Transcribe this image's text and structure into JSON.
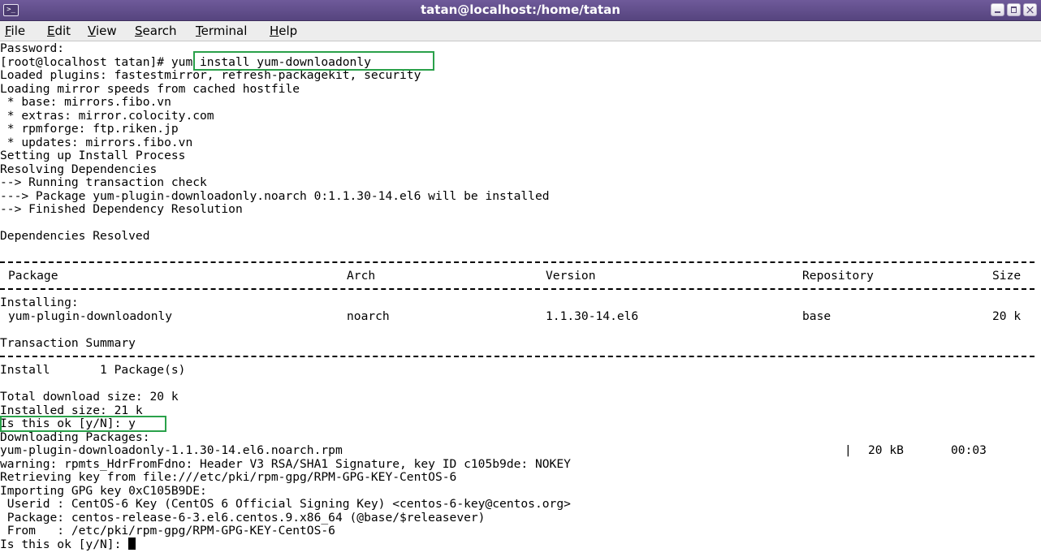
{
  "window": {
    "title": "tatan@localhost:/home/tatan",
    "icon": "terminal-icon"
  },
  "menu": [
    {
      "mnemonic": "F",
      "rest": "ile"
    },
    {
      "mnemonic": "E",
      "rest": "dit"
    },
    {
      "mnemonic": "V",
      "rest": "iew"
    },
    {
      "mnemonic": "S",
      "rest": "earch"
    },
    {
      "mnemonic": "T",
      "rest": "erminal"
    },
    {
      "mnemonic": "H",
      "rest": "elp"
    }
  ],
  "terminal": {
    "lines": [
      "Password:",
      "Loaded plugins: fastestmirror, refresh-packagekit, security",
      "Loading mirror speeds from cached hostfile",
      " * base: mirrors.fibo.vn",
      " * extras: mirror.colocity.com",
      " * rpmforge: ftp.riken.jp",
      " * updates: mirrors.fibo.vn",
      "Setting up Install Process",
      "Resolving Dependencies",
      "--> Running transaction check",
      "---> Package yum-plugin-downloadonly.noarch 0:1.1.30-14.el6 will be installed",
      "--> Finished Dependency Resolution",
      "Dependencies Resolved",
      "Installing:",
      "Transaction Summary",
      "Install       1 Package(s)",
      "Total download size: 20 k",
      "Installed size: 21 k",
      "Is this ok [y/N]: y",
      "Downloading Packages:",
      "warning: rpmts_HdrFromFdno: Header V3 RSA/SHA1 Signature, key ID c105b9de: NOKEY",
      "Retrieving key from file:///etc/pki/rpm-gpg/RPM-GPG-KEY-CentOS-6",
      "Importing GPG key 0xC105B9DE:",
      " Userid : CentOS-6 Key (CentOS 6 Official Signing Key) <centos-6-key@centos.org>",
      " Package: centos-release-6-3.el6.centos.9.x86_64 (@base/$releasever)",
      " From   : /etc/pki/rpm-gpg/RPM-GPG-KEY-CentOS-6",
      "Is this ok [y/N]: "
    ],
    "prompt": "[root@localhost tatan]# ",
    "command": "yum install yum-downloadonly",
    "table": {
      "headers": [
        "Package",
        "Arch",
        "Version",
        "Repository",
        "Size"
      ],
      "row": [
        "yum-plugin-downloadonly",
        "noarch",
        "1.1.30-14.el6",
        "base",
        "20 k"
      ]
    },
    "download": {
      "file": "yum-plugin-downloadonly-1.1.30-14.el6.noarch.rpm",
      "separator": "|",
      "size": "20 kB",
      "time": "00:03"
    },
    "highlight_color": "#2aa14a"
  }
}
